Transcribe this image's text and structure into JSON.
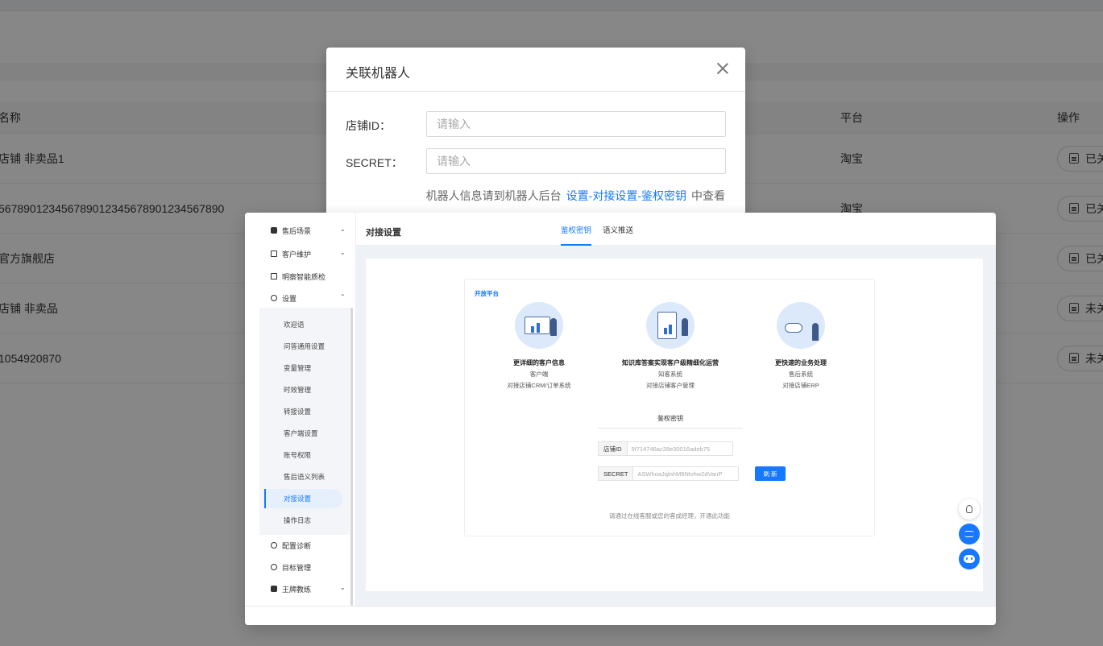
{
  "background": {
    "title": "",
    "table": {
      "headers": {
        "name": "名称",
        "platform": "平台",
        "operation": "操作"
      },
      "rows": [
        {
          "name": "店铺 非卖品1",
          "platform": "淘宝",
          "op": "已关"
        },
        {
          "name": "567890123456789012345678901234567890",
          "platform": "淘宝",
          "op": "已关"
        },
        {
          "name": "官方旗舰店",
          "platform": "",
          "op": "已关"
        },
        {
          "name": "店铺 非卖品",
          "platform": "",
          "op": "未关"
        },
        {
          "name": "1054920870",
          "platform": "",
          "op": "未关"
        }
      ]
    }
  },
  "dialog": {
    "title": "关联机器人",
    "fields": [
      {
        "label": "店铺ID：",
        "placeholder": "请输入",
        "value": ""
      },
      {
        "label": "SECRET：",
        "placeholder": "请输入",
        "value": ""
      }
    ],
    "hint_prefix": "机器人信息请到机器人后台",
    "hint_link": "设置-对接设置-鉴权密钥",
    "hint_suffix": "中查看"
  },
  "help_panel": {
    "sidebar": {
      "top_items": [
        {
          "label": "售后场景",
          "icon": "truck-icon",
          "chevron": "⌄"
        },
        {
          "label": "客户维护",
          "icon": "chat-icon",
          "chevron": "⌄"
        },
        {
          "label": "明察智能质检",
          "icon": "monitor-icon",
          "chevron": ""
        },
        {
          "label": "设置",
          "icon": "gear-icon",
          "chevron": "⌃"
        }
      ],
      "sub_items": [
        "欢迎语",
        "问答通用设置",
        "变量管理",
        "时效管理",
        "转接设置",
        "客户端设置",
        "账号权限",
        "售后语义列表",
        "对接设置",
        "操作日志"
      ],
      "active_sub": "对接设置",
      "bottom_items": [
        {
          "label": "配置诊断",
          "icon": "diagnose-icon",
          "chevron": ""
        },
        {
          "label": "目标管理",
          "icon": "target-icon",
          "chevron": ""
        },
        {
          "label": "王牌教练",
          "icon": "coach-icon",
          "chevron": "⌄"
        }
      ]
    },
    "header_title": "对接设置",
    "tabs": [
      {
        "label": "鉴权密钥",
        "active": true
      },
      {
        "label": "语义推送",
        "active": false
      }
    ],
    "card": {
      "tag": "开放平台",
      "features": [
        {
          "title": "更详细的客户信息",
          "line1": "客户端",
          "line2": "对接店铺CRM/订单系统"
        },
        {
          "title": "知识库答案实现客户级精细化运营",
          "line1": "知客系统",
          "line2": "对接店铺客户管理"
        },
        {
          "title": "更快速的业务处理",
          "line1": "售后系统",
          "line2": "对接店铺ERP"
        }
      ],
      "auth_title": "鉴权密钥",
      "shop_id_key": "店铺ID",
      "shop_id_value": "5f714746ac28e30016adeb75",
      "secret_key": "SECRET",
      "secret_value": "ASWhoaJqlnhM9Ntvhw2dVanP",
      "refresh_label": "刷 新",
      "note": "请通过在线客服或您的客成经理，开通此功能"
    }
  },
  "colors": {
    "accent": "#1677ff",
    "overlay": "rgba(0,0,0,0.47)"
  }
}
